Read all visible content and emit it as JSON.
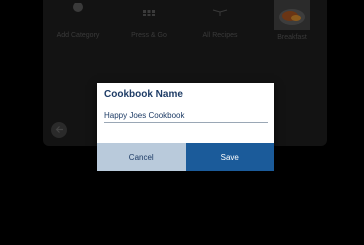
{
  "background_tiles": [
    {
      "label": "Add Category",
      "icon": "plus-circle-icon"
    },
    {
      "label": "Press & Go",
      "icon": "grid-icon"
    },
    {
      "label": "All Recipes",
      "icon": "book-icon"
    },
    {
      "label": "Breakfast",
      "icon": "food-thumbnail"
    }
  ],
  "back_button": {
    "icon": "back-arrow-icon"
  },
  "dialog": {
    "title": "Cookbook Name",
    "input_value": "Happy Joes Cookbook",
    "cancel_label": "Cancel",
    "save_label": "Save"
  },
  "colors": {
    "page_background": "#000000",
    "panel": "#131313",
    "title_text": "#1e3c66",
    "cancel_button": "#b9cadb",
    "save_button": "#1b5b9a"
  }
}
